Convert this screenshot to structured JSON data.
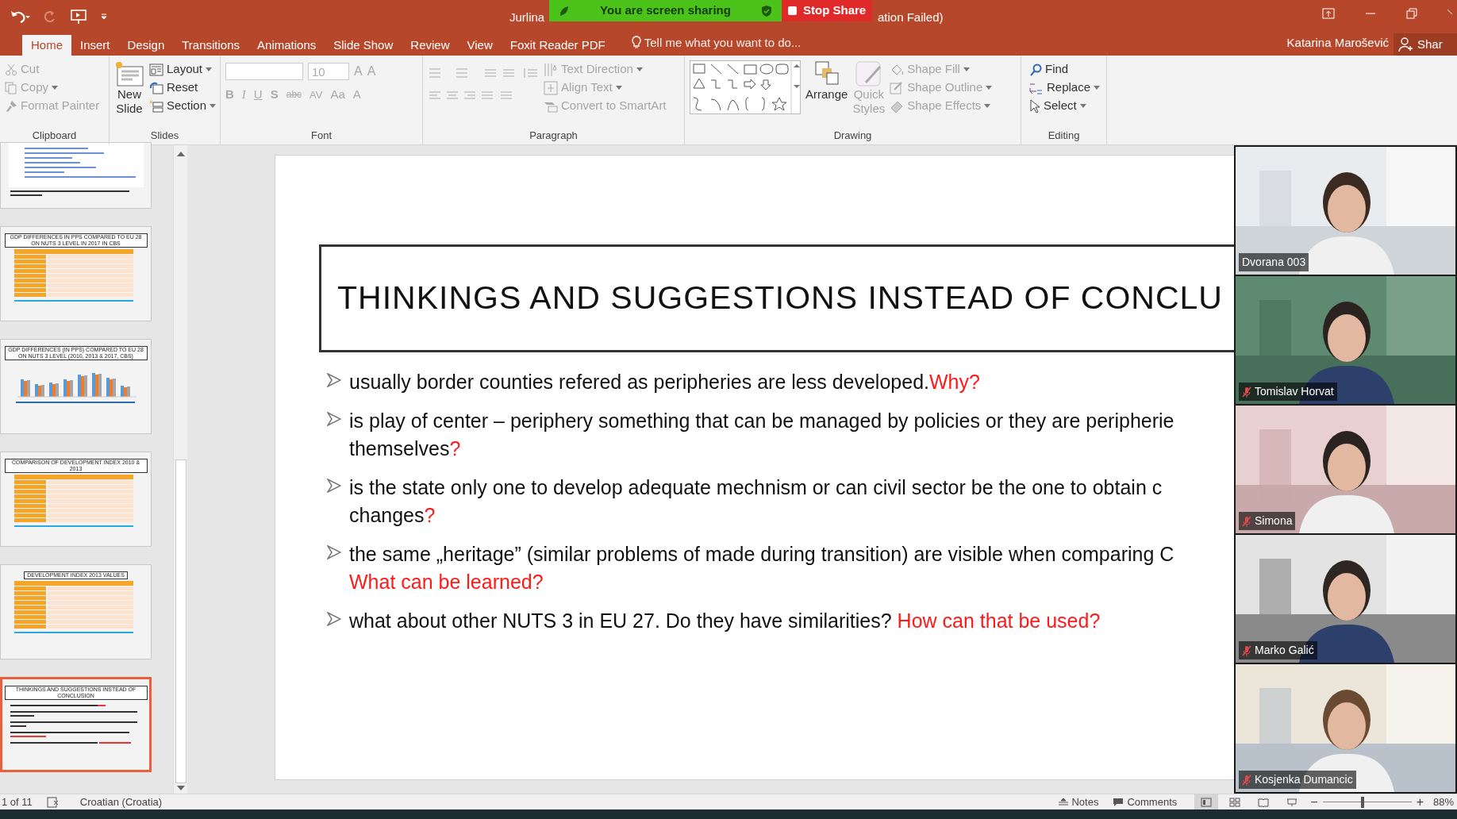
{
  "window": {
    "title_left": "Jurlina",
    "title_right": "ation Failed)"
  },
  "share_banner": {
    "status": "You are screen sharing",
    "stop": "Stop Share"
  },
  "tabs": [
    {
      "label": "Home",
      "selected": true
    },
    {
      "label": "Insert",
      "selected": false
    },
    {
      "label": "Design",
      "selected": false
    },
    {
      "label": "Transitions",
      "selected": false
    },
    {
      "label": "Animations",
      "selected": false
    },
    {
      "label": "Slide Show",
      "selected": false
    },
    {
      "label": "Review",
      "selected": false
    },
    {
      "label": "View",
      "selected": false
    },
    {
      "label": "Foxit Reader PDF",
      "selected": false
    }
  ],
  "tell_me": {
    "placeholder": "Tell me what you want to do..."
  },
  "user": {
    "name": "Katarina Marošević",
    "share": "Shar"
  },
  "ribbon": {
    "clipboard": {
      "label": "Clipboard",
      "items": [
        {
          "label": "Cut",
          "disabled": true
        },
        {
          "label": "Copy",
          "disabled": true
        },
        {
          "label": "Format Painter",
          "disabled": true
        }
      ]
    },
    "slides": {
      "label": "Slides",
      "new_slide": [
        "New",
        "Slide"
      ],
      "items": [
        {
          "label": "Layout",
          "disabled": false
        },
        {
          "label": "Reset",
          "disabled": false
        },
        {
          "label": "Section",
          "disabled": false
        }
      ]
    },
    "font": {
      "label": "Font",
      "font_size_value": "10",
      "glyphs_top": [
        "A",
        "A"
      ],
      "glyphs_bottom": [
        "B",
        "I",
        "U",
        "S",
        "abc",
        "AV",
        "Aa",
        "A"
      ]
    },
    "paragraph": {
      "label": "Paragraph",
      "items": [
        {
          "label": "Text Direction",
          "disabled": true
        },
        {
          "label": "Align Text",
          "disabled": true
        },
        {
          "label": "Convert to SmartArt",
          "disabled": true
        }
      ]
    },
    "drawing": {
      "label": "Drawing",
      "arrange": "Arrange",
      "quick_styles": [
        "Quick",
        "Styles"
      ],
      "items": [
        {
          "label": "Shape Fill",
          "disabled": true
        },
        {
          "label": "Shape Outline",
          "disabled": true
        },
        {
          "label": "Shape Effects",
          "disabled": true
        }
      ]
    },
    "editing": {
      "label": "Editing",
      "items": [
        {
          "label": "Find",
          "disabled": false
        },
        {
          "label": "Replace",
          "disabled": false
        },
        {
          "label": "Select",
          "disabled": false
        }
      ]
    }
  },
  "thumbnails": [
    {
      "kind": "bars",
      "selected": false
    },
    {
      "kind": "table",
      "title": "GDP DIFFERENCES IN PPS COMPARED TO EU 28 ON NUTS 3 LEVEL IN 2017 IN CBS",
      "selected": false
    },
    {
      "kind": "columns",
      "title": "GDP DIFFERENCES (IN PPS) COMPARED TO EU 28 ON NUTS 3 LEVEL (2010, 2013 & 2017, CBS)",
      "selected": false
    },
    {
      "kind": "table",
      "title": "COMPARISON OF DEVELOPMENT INDEX 2010 & 2013",
      "selected": false
    },
    {
      "kind": "table",
      "title": "DEVELOPMENT INDEX 2013 VALUES",
      "selected": false
    },
    {
      "kind": "text",
      "title": "THINKINGS AND SUGGESTIONS INSTEAD OF CONCLUSION",
      "selected": true
    }
  ],
  "slide": {
    "title": "THINKINGS AND SUGGESTIONS INSTEAD OF CONCLU",
    "bullets": [
      {
        "lines": [
          [
            {
              "kind": "plain",
              "text": "usually border counties refered as peripheries are less developed."
            },
            {
              "kind": "question",
              "text": "Why?"
            }
          ]
        ]
      },
      {
        "lines": [
          [
            {
              "kind": "plain",
              "text": "is play of center – periphery something that can be managed by policies or they are peripherie"
            }
          ],
          [
            {
              "kind": "plain",
              "text": "themselves"
            },
            {
              "kind": "question",
              "text": "?"
            }
          ]
        ]
      },
      {
        "lines": [
          [
            {
              "kind": "plain",
              "text": "is the state only one to develop adequate mechnism or can civil sector be the one to obtain c"
            }
          ],
          [
            {
              "kind": "plain",
              "text": "changes"
            },
            {
              "kind": "question",
              "text": "?"
            }
          ]
        ]
      },
      {
        "lines": [
          [
            {
              "kind": "plain",
              "text": "the same „heritage” (similar problems of made during transition) are visible when comparing C"
            }
          ],
          [
            {
              "kind": "question",
              "text": "What can be learned?"
            }
          ]
        ]
      },
      {
        "lines": [
          [
            {
              "kind": "plain",
              "text": "what about other NUTS 3 in EU 27. Do they have similarities? "
            },
            {
              "kind": "question",
              "text": "How can that be used?"
            }
          ]
        ]
      }
    ]
  },
  "participants": [
    {
      "name": "Dvorana 003",
      "muted": false
    },
    {
      "name": "Tomislav Horvat",
      "muted": true
    },
    {
      "name": "Simona",
      "muted": true
    },
    {
      "name": "Marko Galić",
      "muted": true
    },
    {
      "name": "Kosjenka Dumancic",
      "muted": true
    }
  ],
  "status_bar": {
    "slide": "1 of 11",
    "language": "Croatian (Croatia)",
    "notes": "Notes",
    "comments": "Comments",
    "zoom": "88%",
    "zoom_out": "−",
    "zoom_in": "+",
    "zoom_slider": {
      "level": 0.45
    }
  }
}
